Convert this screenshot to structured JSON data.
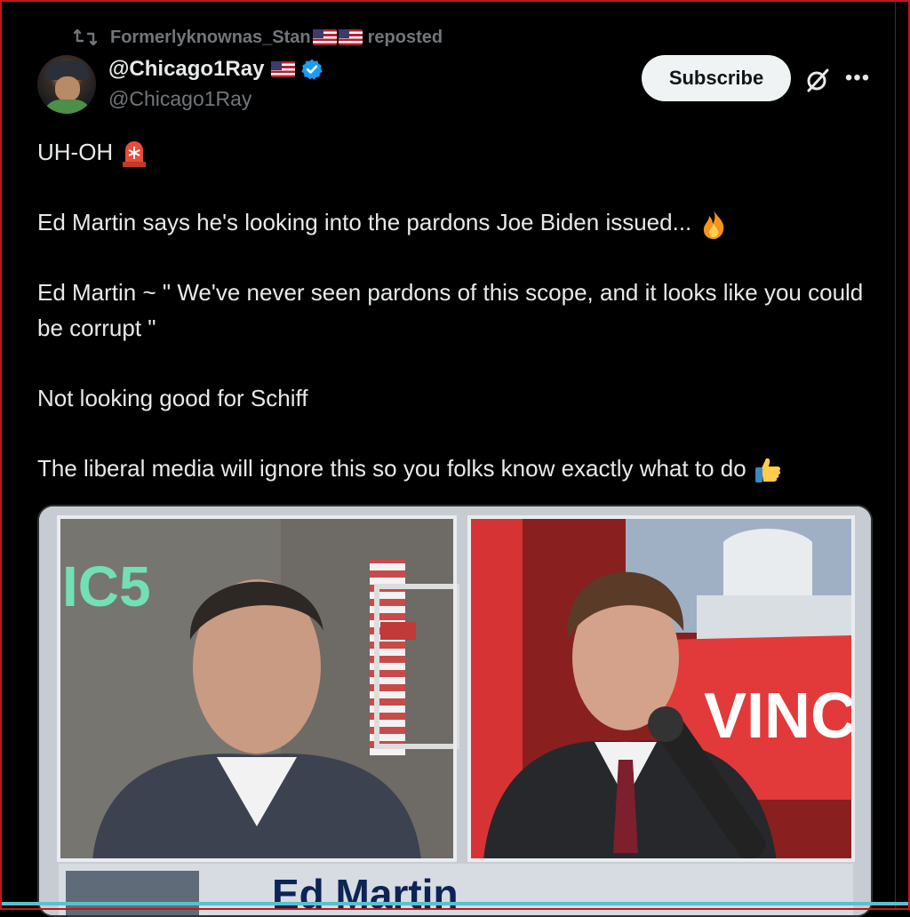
{
  "repost": {
    "user": "Formerlyknownas_Stan",
    "action": "reposted"
  },
  "author": {
    "display_name": "@Chicago1Ray",
    "handle": "@Chicago1Ray",
    "verified": true
  },
  "actions": {
    "subscribe_label": "Subscribe"
  },
  "post": {
    "lines": [
      "UH-OH",
      "Ed Martin says he's looking into the pardons Joe Biden issued...",
      "Ed Martin ~ \" We've never seen pardons of this scope, and it looks like you could be corrupt \"",
      "Not looking good for Schiff",
      "The liberal media will ignore this so you folks know exactly what to do"
    ]
  },
  "media": {
    "left_bg_text": "IC5",
    "right_bg_text": "VINC",
    "nameplate": "Ed Martin"
  },
  "colors": {
    "background": "#000000",
    "text": "#e7e9ea",
    "muted": "#71767b",
    "verified": "#1d9bf0",
    "subscribe_bg": "#eff3f4"
  },
  "icons": [
    "repost-icon",
    "verified-badge-icon",
    "grok-icon",
    "more-icon",
    "siren-emoji",
    "fire-emoji",
    "thumbs-up-emoji"
  ]
}
